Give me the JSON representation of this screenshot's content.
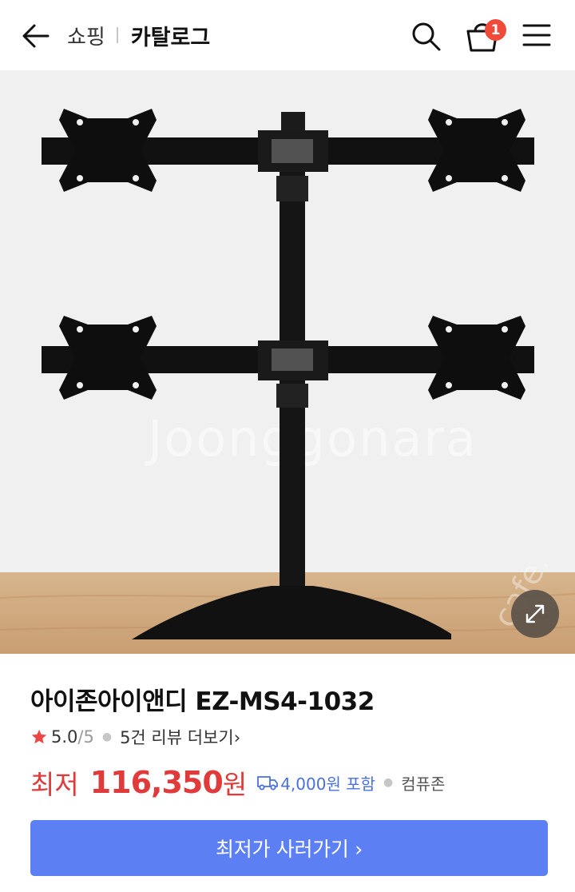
{
  "header": {
    "breadcrumb_shop": "쇼핑",
    "breadcrumb_catalog": "카탈로그",
    "cart_count": "1",
    "icons": [
      "back-arrow-icon",
      "search-icon",
      "shopping-bag-icon",
      "hamburger-menu-icon"
    ]
  },
  "hero": {
    "watermark": "Joonggonara",
    "watermark_side": "cafe.",
    "zoom_icon": "expand-icon"
  },
  "product": {
    "title": "아이존아이앤디 EZ-MS4-1032",
    "rating": "5.0",
    "rating_max": "/5",
    "review_link": "5건 리뷰 더보기",
    "review_chevron": "›",
    "price_label": "최저",
    "price": "116,350",
    "price_unit": "원",
    "shipping": "4,000원 포함",
    "seller": "컴퓨존"
  },
  "cta": {
    "label": "최저가 사러가기 ›"
  },
  "colors": {
    "accent_red": "#e03a3a",
    "cta_blue": "#5c7ff3",
    "shipping_blue": "#4a6fe0",
    "badge": "#f04a3a"
  }
}
